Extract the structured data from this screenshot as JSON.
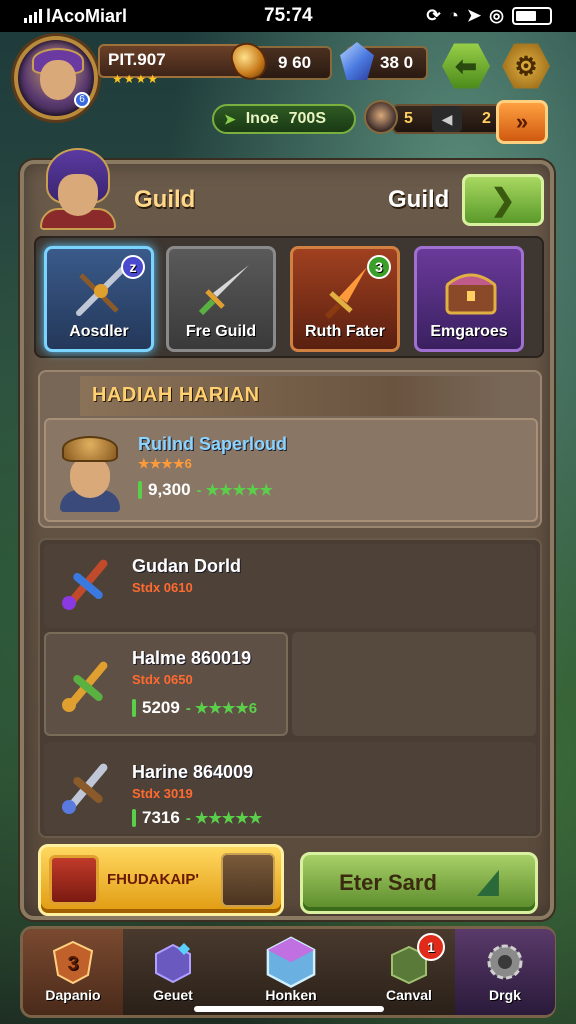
{
  "status_bar": {
    "carrier": "lAcoMiarl",
    "time": "75:74"
  },
  "player": {
    "name": "PIT.907",
    "stars": "★★★★",
    "level_badge": "6"
  },
  "resources": {
    "gold": "9 60",
    "gems": "38 0"
  },
  "hud": {
    "pill_label": "Inoe",
    "pill_value": "700S",
    "level_num": "5",
    "level_right": "2"
  },
  "panel": {
    "title_left": "Guild",
    "title_right": "Guild"
  },
  "categories": [
    {
      "label": "Aosdler",
      "badge": "z"
    },
    {
      "label": "Fre Guild",
      "badge": ""
    },
    {
      "label": "Ruth Fater",
      "badge": "3"
    },
    {
      "label": "Emgaroes",
      "badge": ""
    }
  ],
  "daily": {
    "banner": "HADIAH HARIAN",
    "title": "Ruilnd Saperloud",
    "sub": "★★★★6",
    "value": "9,300",
    "stars": "- ★★★★★"
  },
  "items": [
    {
      "title": "Gudan Dorld",
      "sub": "Stdx 0610",
      "value": "",
      "stars": ""
    },
    {
      "title": "Halme 860019",
      "sub": "Stdx 0650",
      "value": "5209",
      "stars": "- ★★★★6"
    },
    {
      "title": "Harine 864009",
      "sub": "Stdx 3019",
      "value": "7316",
      "stars": "- ★★★★★"
    }
  ],
  "buttons": {
    "reward": "FHUDAKAIP'",
    "enter": "Eter Sard"
  },
  "nav": [
    {
      "label": "Dapanio",
      "icon_text": "3"
    },
    {
      "label": "Geuet"
    },
    {
      "label": "Honken"
    },
    {
      "label": "Canval",
      "badge": "1"
    },
    {
      "label": "Drgk"
    }
  ],
  "colors": {
    "accent_green": "#5ad04a",
    "gold": "#ffc520",
    "highlight_blue": "#7ad4ff"
  }
}
